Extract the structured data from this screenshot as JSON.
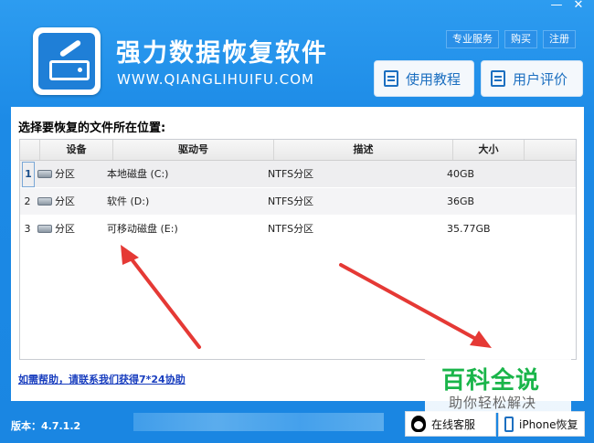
{
  "window": {
    "minimize_glyph": "—",
    "close_glyph": "✕"
  },
  "app": {
    "title": "强力数据恢复软件",
    "url": "WWW.QIANGLIHUIFU.COM"
  },
  "top_links": [
    "专业服务",
    "购买",
    "注册"
  ],
  "buttons": {
    "tutorial": "使用教程",
    "review": "用户评价"
  },
  "panel": {
    "title": "选择要恢复的文件所在位置:",
    "columns": [
      "设备",
      "驱动号",
      "描述",
      "大小"
    ],
    "rows": [
      {
        "num": "1",
        "device": "分区",
        "drive": "本地磁盘 (C:)",
        "desc": "NTFS分区",
        "size": "40GB",
        "selected": true
      },
      {
        "num": "2",
        "device": "分区",
        "drive": "软件 (D:)",
        "desc": "NTFS分区",
        "size": "36GB",
        "selected": false
      },
      {
        "num": "3",
        "device": "分区",
        "drive": "可移动磁盘 (E:)",
        "desc": "NTFS分区",
        "size": "35.77GB",
        "selected": false
      }
    ],
    "help_link": "如需帮助，请联系我们获得7*24协助"
  },
  "footer": {
    "version": "版本：4.7.1.2",
    "service": "在线客服",
    "iphone": "iPhone恢复"
  },
  "watermark": {
    "title": "百科全说",
    "subtitle": "助你轻松解决"
  },
  "colors": {
    "accent": "#1a86e2",
    "arrow": "#e53935",
    "watermark": "#1ab54a"
  },
  "icons": [
    "minimize-icon",
    "close-icon",
    "app-logo-icon",
    "tutorial-icon",
    "review-icon",
    "disk-icon",
    "qq-icon",
    "iphone-icon"
  ]
}
